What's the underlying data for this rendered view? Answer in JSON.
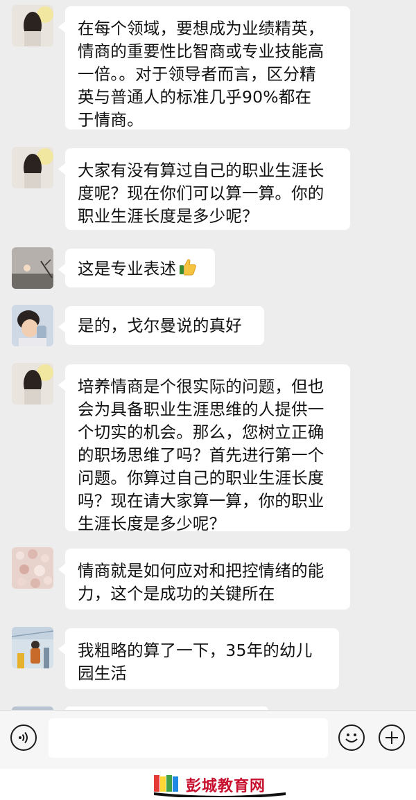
{
  "messages": [
    {
      "lines": [
        "在每个领域，要想成为业绩精英，",
        "情商的重要性比智商或专业技能高",
        "一倍。。对于领导者而言，区分精",
        "英与普通人的标准几乎90%都在",
        "于情商。"
      ]
    },
    {
      "lines": [
        "大家有没有算过自己的职业生涯长",
        "度呢？现在你们可以算一算。你的",
        "职业生涯长度是多少呢？"
      ]
    },
    {
      "lines": [
        "这是专业表述"
      ],
      "emoji": "thumbs-up"
    },
    {
      "lines": [
        "是的，戈尔曼说的真好"
      ]
    },
    {
      "lines": [
        "培养情商是个很实际的问题，但也",
        "会为具备职业生涯思维的人提供一",
        "个切实的机会。那么，您树立正确",
        "的职场思维了吗？首先进行第一个",
        "问题。你算过自己的职业生涯长度",
        "吗？现在请大家算一算，你的职业",
        "生涯长度是多少呢？"
      ]
    },
    {
      "lines": [
        "情商就是如何应对和把控情绪的能",
        "力，这个是成功的关键所在"
      ]
    },
    {
      "lines": [
        "我粗略的算了一下，35年的幼儿",
        "园生活"
      ]
    }
  ],
  "input_bar": {
    "voice_icon": "voice-icon",
    "emoji_icon": "emoji-icon",
    "plus_icon": "plus-icon",
    "input_value": ""
  },
  "watermark": {
    "text": "彭城教育网"
  },
  "colors": {
    "background": "#ededed",
    "bubble": "#ffffff",
    "watermark": "#c8102e"
  }
}
